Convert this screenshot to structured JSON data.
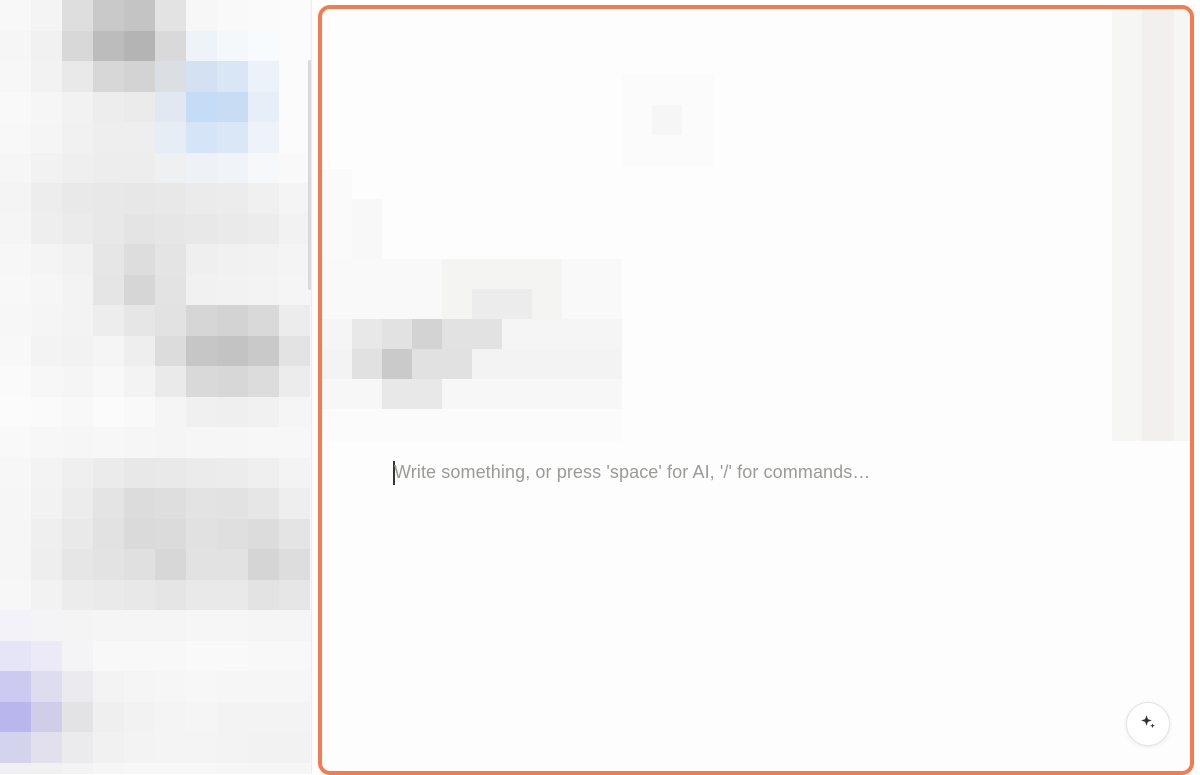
{
  "editor": {
    "placeholder": "Write something, or press 'space' for AI, '/' for commands…"
  },
  "ai_button": {
    "icon": "sparkles-icon"
  },
  "colors": {
    "focus_border": "#f47a4f",
    "placeholder_text": "#9a9a97",
    "sidebar_highlight": "#c5dcf6",
    "sidebar_accent": "#b8b6ec"
  }
}
